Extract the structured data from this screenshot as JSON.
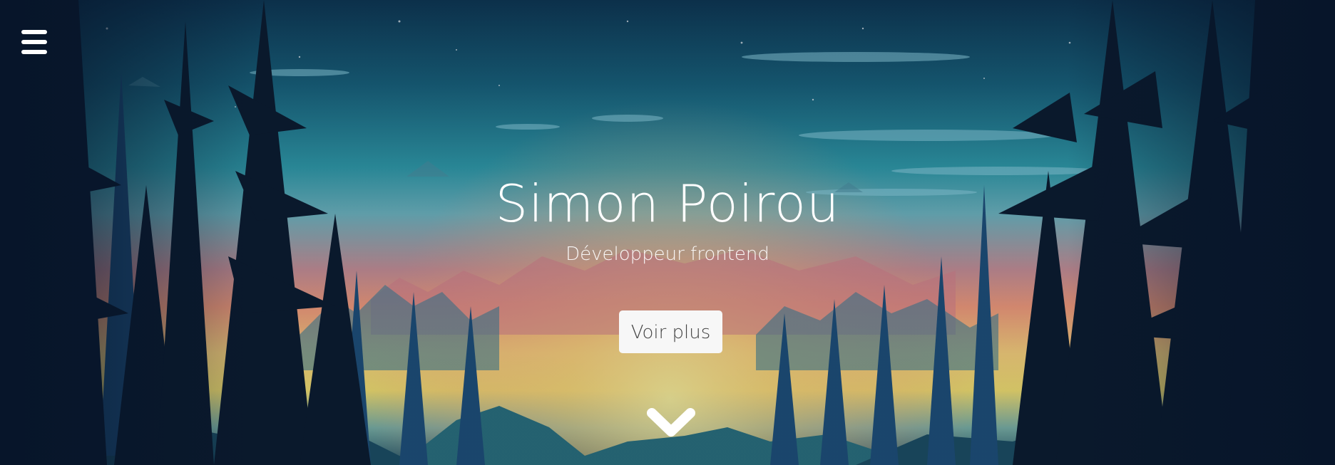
{
  "menu": {
    "icon": "hamburger-menu-icon"
  },
  "hero": {
    "title": "Simon Poirou",
    "subtitle": "Développeur frontend",
    "cta_label": "Voir plus",
    "scroll_icon": "chevron-down-icon"
  },
  "colors": {
    "text": "#ffffff",
    "button_bg": "#f7f7f7",
    "button_text": "#444444",
    "sky_top": "#0d3550",
    "sunset": "#f59b7a",
    "sun_glow": "#f5e06f",
    "tree_dark": "#0b1a2c"
  }
}
